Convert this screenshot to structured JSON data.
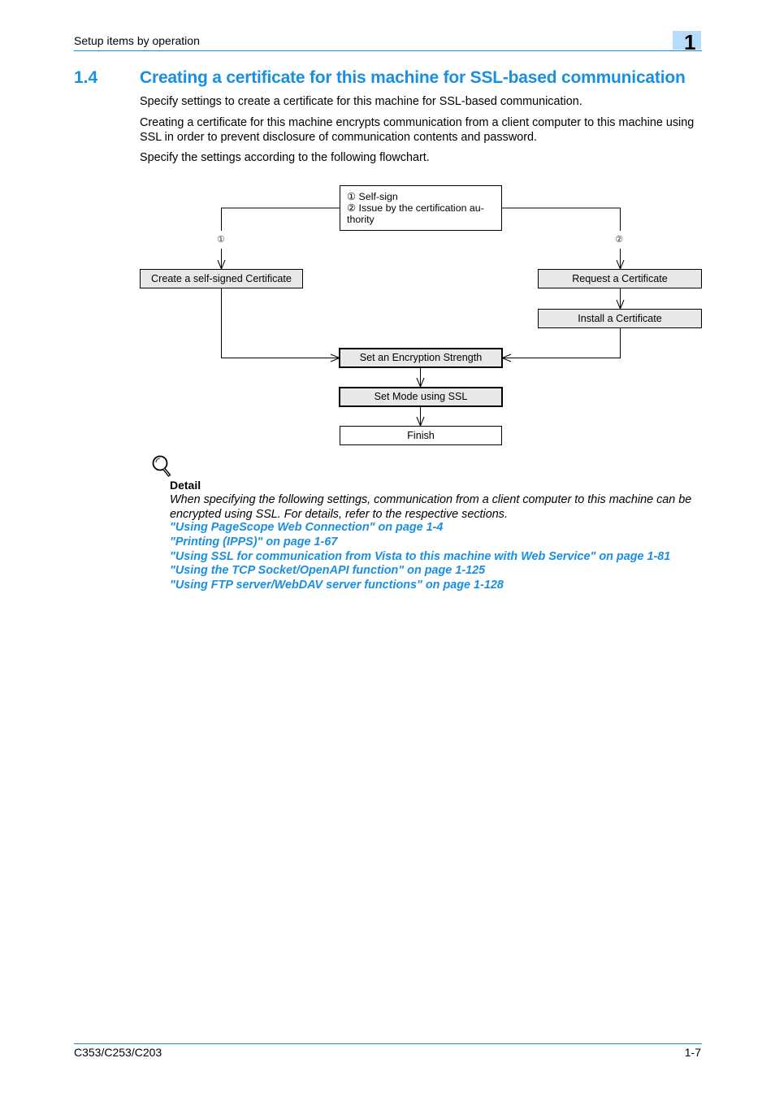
{
  "header": {
    "running_head": "Setup items by operation",
    "chapter_number": "1"
  },
  "section": {
    "number": "1.4",
    "title": "Creating a certificate for this machine for SSL-based communication"
  },
  "body": {
    "paragraphs": [
      "Specify settings to create a certificate for this machine for SSL-based communication.",
      "Creating a certificate for this machine encrypts communication from a client computer to this machine using SSL in order to prevent disclosure of communication contents and password.",
      "Specify the settings according to the following flowchart."
    ]
  },
  "flowchart": {
    "decision": {
      "line1": "① Self-sign",
      "line2": "② Issue by the certification au-",
      "line3": "thority"
    },
    "branch_labels": {
      "left": "①",
      "right": "②"
    },
    "steps": {
      "self_signed": "Create a self-signed Certificate",
      "request": "Request a Certificate",
      "install": "Install a Certificate",
      "encryption": "Set an Encryption Strength",
      "ssl_mode": "Set Mode using SSL",
      "finish": "Finish"
    }
  },
  "detail": {
    "icon": "magnifier-icon",
    "heading": "Detail",
    "text": "When specifying the following settings, communication from a client computer to this machine can be encrypted using SSL. For details, refer to the respective sections.",
    "links": [
      "\"Using PageScope Web Connection\" on page 1-4",
      "\"Printing (IPPS)\" on page 1-67",
      "\"Using SSL for communication from Vista to this machine with Web Service\" on page 1-81",
      "\"Using the TCP Socket/OpenAPI function\" on page 1-125",
      "\"Using FTP server/WebDAV server functions\" on page 1-128"
    ]
  },
  "footer": {
    "model": "C353/C253/C203",
    "page": "1-7"
  },
  "colors": {
    "accent": "#1a8fe0",
    "chapter_tab": "#b7dcfb",
    "box_fill": "#e8e8e8"
  }
}
